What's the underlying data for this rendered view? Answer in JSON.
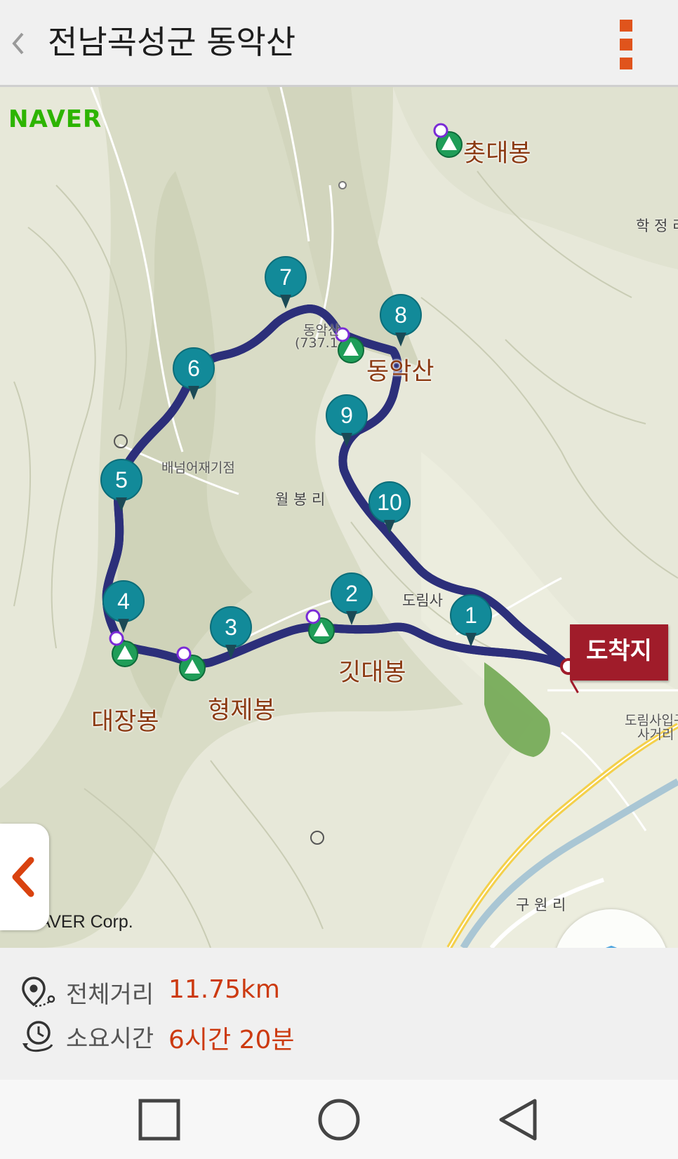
{
  "header": {
    "title": "전남곡성군 동악산",
    "back_icon": "chevron-left-icon",
    "menu_icon": "more-vertical-icon",
    "accent_color": "#e0541c"
  },
  "map": {
    "provider_logo": "NAVER",
    "copyright": "© NAVER Corp.",
    "route_color": "#4b44a8",
    "waypoints": [
      "1",
      "2",
      "3",
      "4",
      "5",
      "6",
      "7",
      "8",
      "9",
      "10"
    ],
    "peaks": [
      "촛대봉",
      "동악산",
      "깃대봉",
      "형제봉",
      "대장봉"
    ],
    "small_labels": {
      "summit": "동악산",
      "summit_elev": "(737.1",
      "hakjeong": "학 정 리",
      "baenoem": "배넘어재기점",
      "wolbong": "월 봉 리",
      "dorimsa": "도림사",
      "junction_1": "도림사입구",
      "junction_2": "사거리",
      "guwon": "구 원 리"
    },
    "destination_label": "도착지",
    "destination_color": "#a01c2a",
    "layer_icon": "layers-icon",
    "side_tab_icon": "chevron-left-icon"
  },
  "summary": {
    "distance_label": "전체거리",
    "distance_value": "11.75km",
    "time_label": "소요시간",
    "time_value": "6시간 20분"
  },
  "navbar": {
    "recent_icon": "square-icon",
    "home_icon": "circle-icon",
    "back_icon": "triangle-back-icon"
  }
}
